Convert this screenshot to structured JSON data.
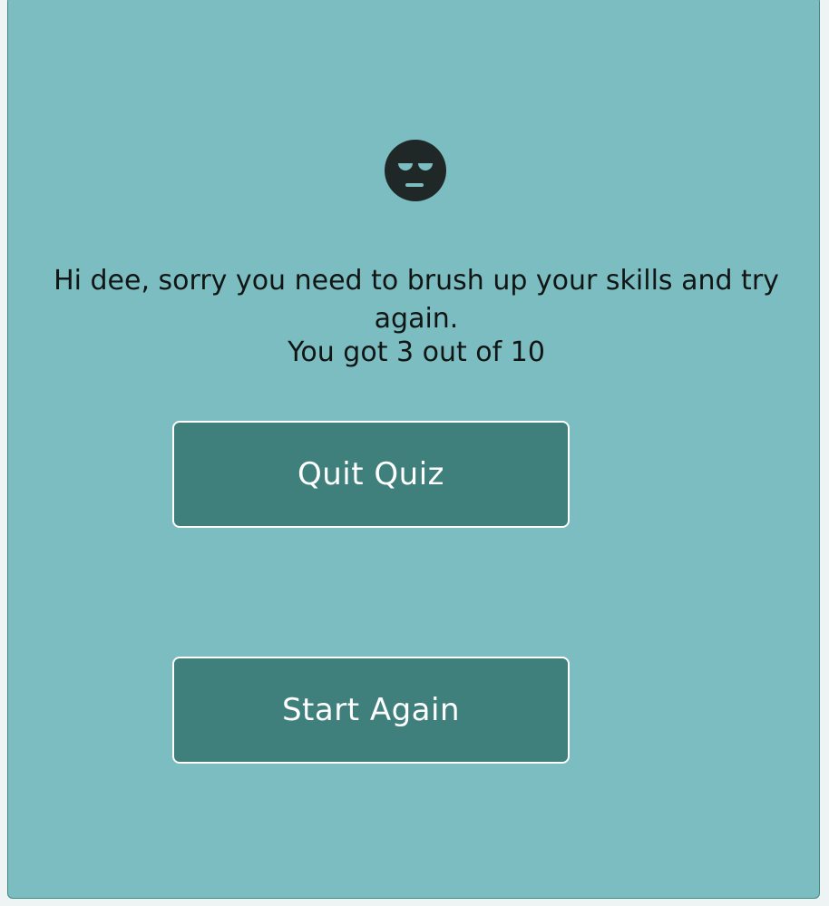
{
  "result": {
    "message": "Hi dee, sorry you need to brush up your skills and try again.",
    "score": "You got 3 out of 10",
    "emoji_icon": "face-with-rolling-eyes-icon"
  },
  "buttons": {
    "quit_label": "Quit Quiz",
    "start_again_label": "Start Again"
  },
  "colors": {
    "panel_background": "#7bbdc1",
    "button_background": "#3f807c",
    "button_border": "#ffffff",
    "text": "#111614"
  }
}
